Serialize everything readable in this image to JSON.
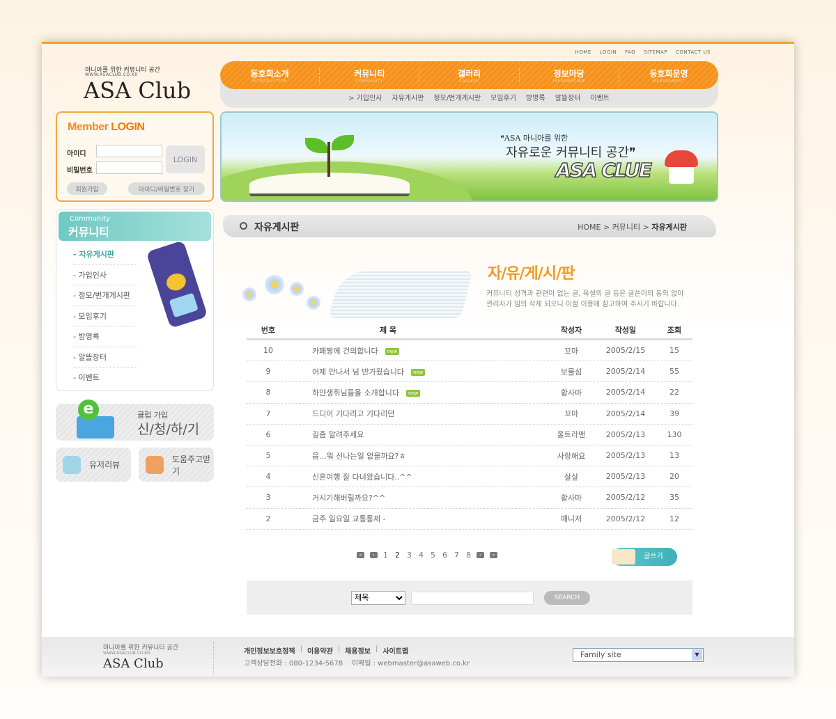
{
  "top_links": [
    "HOME",
    "LOGIN",
    "FAQ",
    "SITEMAP",
    "CONTACT US"
  ],
  "logo": {
    "tagline": "마니아를 위한 커뮤니티 공간",
    "url": "WWW.ASACLUB.CO.KR",
    "name": "ASA Club"
  },
  "nav": [
    {
      "label": "동호회소개",
      "sub": "INTRODUCTION"
    },
    {
      "label": "커뮤니티",
      "sub": "COMMUNITY"
    },
    {
      "label": "갤러리",
      "sub": "GALLERY"
    },
    {
      "label": "정보마당",
      "sub": "INFORMATION"
    },
    {
      "label": "동호회운영",
      "sub": "MANAGEMENT"
    }
  ],
  "subnav": [
    "> 가입인사",
    "자유게시판",
    "정모/번개게시판",
    "모임후기",
    "방명록",
    "알뜰장터",
    "이벤트"
  ],
  "login": {
    "title_a": "Member ",
    "title_b": "LOGIN",
    "id_label": "아이디",
    "pw_label": "비밀번호",
    "button": "LOGIN",
    "join": "회원가입",
    "find": "아이디/비밀번호 찾기"
  },
  "banner": {
    "line1": "ASA 마니아를 위한",
    "line2": "자유로운 커뮤니티 공간",
    "brand": "ASA CLUE"
  },
  "sidebar": {
    "title_en": "Community",
    "title": "커뮤니티",
    "items": [
      "- 자유게시판",
      "- 가입인사",
      "- 정모/번개게시판",
      "- 모임후기",
      "- 방명록",
      "- 알뜰장터",
      "- 이벤트"
    ],
    "active": 0
  },
  "join_box": {
    "small": "클럽 가입",
    "big": "신/청/하/기"
  },
  "quick": [
    "유저리뷰",
    "도움주고받기"
  ],
  "page": {
    "title": "자유게시판",
    "breadcrumb": [
      "HOME",
      "커뮤니티",
      "자유게시판"
    ],
    "board_title": "자/유/게/시/판",
    "desc": [
      "커뮤니티 성격과 관련이 없는 글, 욕설의 글 등은 글쓴이의 동의 없이",
      "관리자가 임의 삭제 되오니 이점 이용에 참고하여 주시기 바랍니다."
    ]
  },
  "table": {
    "headers": [
      "번호",
      "제 목",
      "작성자",
      "작성일",
      "조회"
    ],
    "new_badge": "new",
    "rows": [
      {
        "no": "10",
        "title": "카페짱께 건의합니다",
        "author": "꼬마",
        "date": "2005/2/15",
        "views": "15",
        "new": true
      },
      {
        "no": "9",
        "title": "어제 만나서 넘 반가웠습니다",
        "author": "보물섬",
        "date": "2005/2/14",
        "views": "55",
        "new": true
      },
      {
        "no": "8",
        "title": "하얀생쥐님들을 소개합니다",
        "author": "황사마",
        "date": "2005/2/14",
        "views": "22",
        "new": true
      },
      {
        "no": "7",
        "title": "드디어 기다리고 기다리던",
        "author": "꼬마",
        "date": "2005/2/14",
        "views": "39",
        "new": false
      },
      {
        "no": "6",
        "title": "길좀 알려주세요",
        "author": "울트라맨",
        "date": "2005/2/13",
        "views": "130",
        "new": false
      },
      {
        "no": "5",
        "title": "음...뭐 신나는일 없을까요?ㅎ",
        "author": "사랑해요",
        "date": "2005/2/13",
        "views": "13",
        "new": false
      },
      {
        "no": "4",
        "title": "신혼여행 잘 다녀왔습니다..^^",
        "author": "살살",
        "date": "2005/2/13",
        "views": "20",
        "new": false
      },
      {
        "no": "3",
        "title": "거시기해버릴까요?^^",
        "author": "황사마",
        "date": "2005/2/12",
        "views": "35",
        "new": false
      },
      {
        "no": "2",
        "title": "금주 일요일 교통통제 -",
        "author": "매니저",
        "date": "2005/2/12",
        "views": "12",
        "new": false
      }
    ]
  },
  "pagination": {
    "pages": [
      "1",
      "2",
      "3",
      "4",
      "5",
      "6",
      "7",
      "8"
    ],
    "current": "2"
  },
  "write_button": "글쓰기",
  "search": {
    "field": "제목",
    "button": "SEARCH",
    "value": ""
  },
  "footer": {
    "tagline": "마니아를 위한 커뮤니티 공간",
    "url": "WWW.ASACLUB.CO.KR",
    "name": "ASA Club",
    "links": [
      "개인정보보호정책",
      "이용약관",
      "채용정보",
      "사이트맵"
    ],
    "info": "고객상담전화 : 080-1234-5678    이메일 : webmaster@asaweb.co.kr",
    "family_site": "Family site"
  }
}
